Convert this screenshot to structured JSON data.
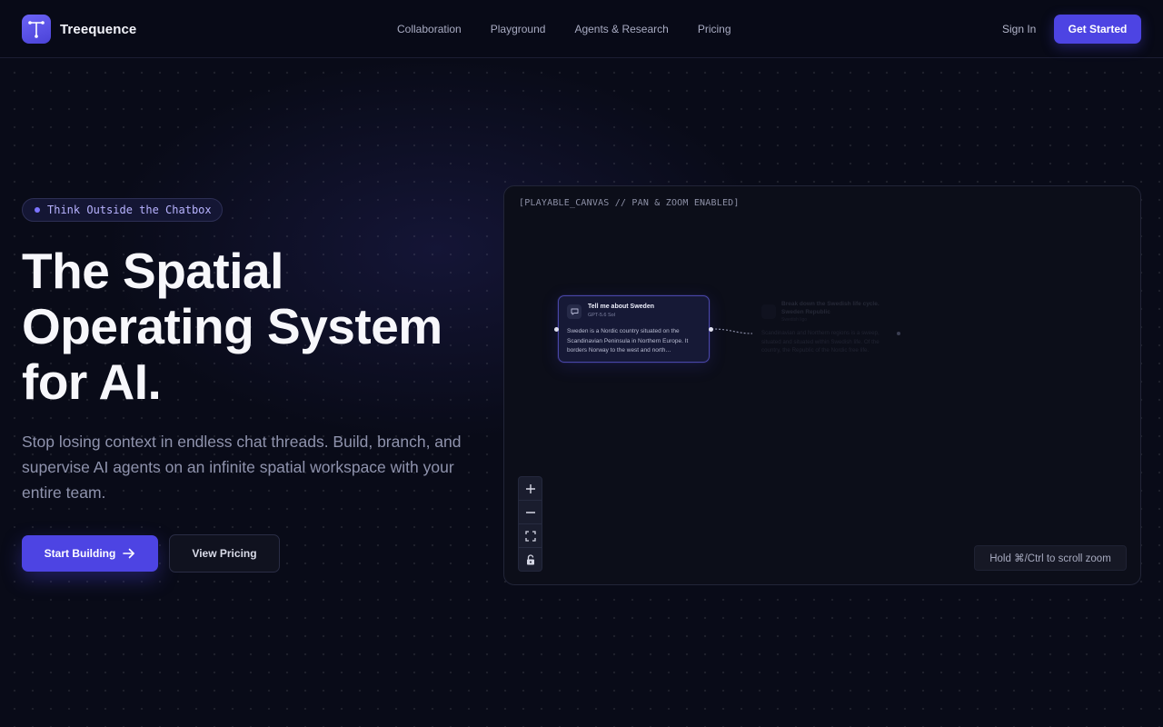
{
  "brand": {
    "name": "Treequence"
  },
  "nav": {
    "links": [
      "Collaboration",
      "Playground",
      "Agents & Research",
      "Pricing"
    ],
    "sign_in": "Sign In",
    "get_started": "Get Started"
  },
  "hero": {
    "badge": "Think Outside the Chatbox",
    "title_lines": [
      "The Spatial",
      "Operating System",
      "for AI."
    ],
    "subtitle": "Stop losing context in endless chat threads. Build, branch, and supervise AI agents on an infinite spatial workspace with your entire team.",
    "primary_cta": "Start Building",
    "secondary_cta": "View Pricing"
  },
  "canvas": {
    "label": "[PLAYABLE_CANVAS // PAN & ZOOM ENABLED]",
    "node": {
      "title": "Tell me about Sweden",
      "model": "GPT-5.6 Sol",
      "body": "Sweden is a Nordic country situated on the Scandinavian Peninsula in Northern Europe. It borders Norway to the west and north…"
    },
    "ghost_node": {
      "title": "Break down the Swedish life cycle. Sweden Republic",
      "model": "Swedish ligo",
      "body": "Scandinavian and Northern regions is a sweep, situated and situated within Swedish life. Of the country, the Republic of the Nordic free life."
    },
    "hint": "Hold ⌘/Ctrl to scroll zoom",
    "controls": [
      "zoom-in-icon",
      "zoom-out-icon",
      "fit-view-icon",
      "lock-icon"
    ]
  },
  "colors": {
    "accent": "#4d44e3",
    "background": "#090b18"
  }
}
